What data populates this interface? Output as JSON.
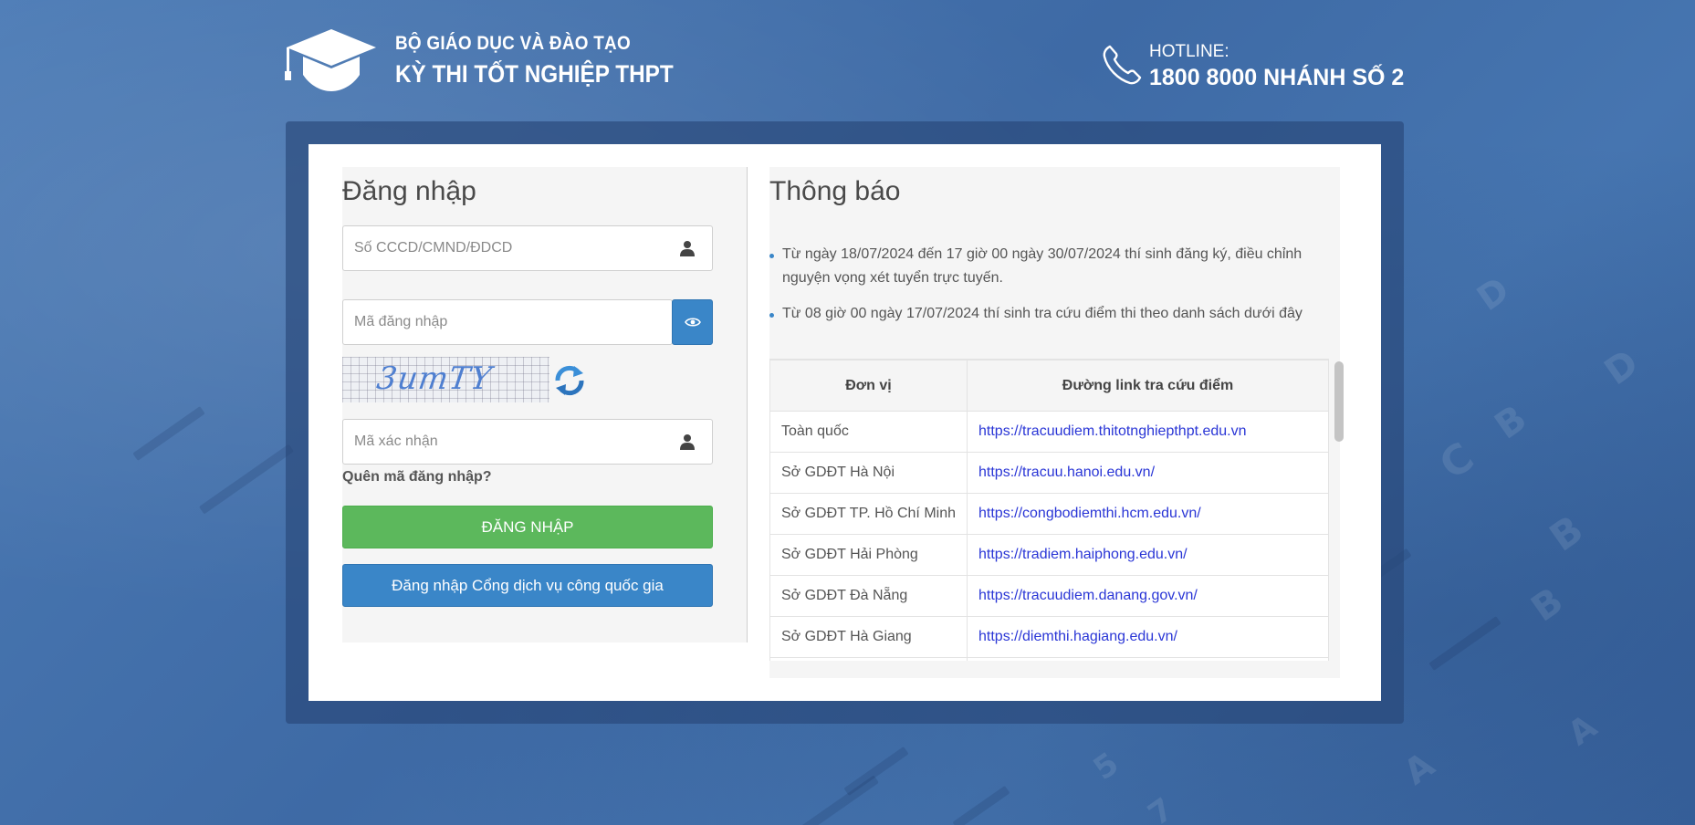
{
  "header": {
    "org_line1": "BỘ GIÁO DỤC VÀ ĐÀO TẠO",
    "org_line2": "KỲ THI TỐT NGHIỆP THPT",
    "hotline_label": "HOTLINE:",
    "hotline_number": "1800 8000 NHÁNH SỐ 2",
    "logo_icon": "graduation-cap-icon",
    "phone_icon": "phone-icon"
  },
  "login": {
    "title": "Đăng nhập",
    "id_placeholder": "Số CCCD/CMND/ĐDCD",
    "code_placeholder": "Mã đăng nhập",
    "captcha_text": "3umTY",
    "verify_placeholder": "Mã xác nhận",
    "forgot_label": "Quên mã đăng nhập?",
    "login_button": "ĐĂNG NHẬP",
    "national_login_button": "Đăng nhập Cổng dịch vụ công quốc gia"
  },
  "notice": {
    "title": "Thông báo",
    "items": [
      "Từ ngày 18/07/2024 đến 17 giờ 00 ngày 30/07/2024 thí sinh đăng ký, điều chỉnh nguyện vọng xét tuyển trực tuyến.",
      "Từ 08 giờ 00 ngày 17/07/2024 thí sinh tra cứu điểm thi theo danh sách dưới đây"
    ],
    "table": {
      "headers": [
        "Đơn vị",
        "Đường link tra cứu điểm"
      ],
      "rows": [
        {
          "unit": "Toàn quốc",
          "link": "https://tracuudiem.thitotnghiepthpt.edu.vn"
        },
        {
          "unit": "Sở GDĐT Hà Nội",
          "link": "https://tracuu.hanoi.edu.vn/"
        },
        {
          "unit": "Sở GDĐT TP. Hồ Chí Minh",
          "link": "https://congbodiemthi.hcm.edu.vn/"
        },
        {
          "unit": "Sở GDĐT Hải Phòng",
          "link": "https://tradiem.haiphong.edu.vn/"
        },
        {
          "unit": "Sở GDĐT Đà Nẵng",
          "link": "https://tracuudiem.danang.gov.vn/"
        },
        {
          "unit": "Sở GDĐT Hà Giang",
          "link": "https://diemthi.hagiang.edu.vn/"
        }
      ]
    }
  },
  "colors": {
    "background": "#4573ad",
    "primary": "#3a86c8",
    "success": "#5cb85c",
    "link": "#2a36d6"
  }
}
